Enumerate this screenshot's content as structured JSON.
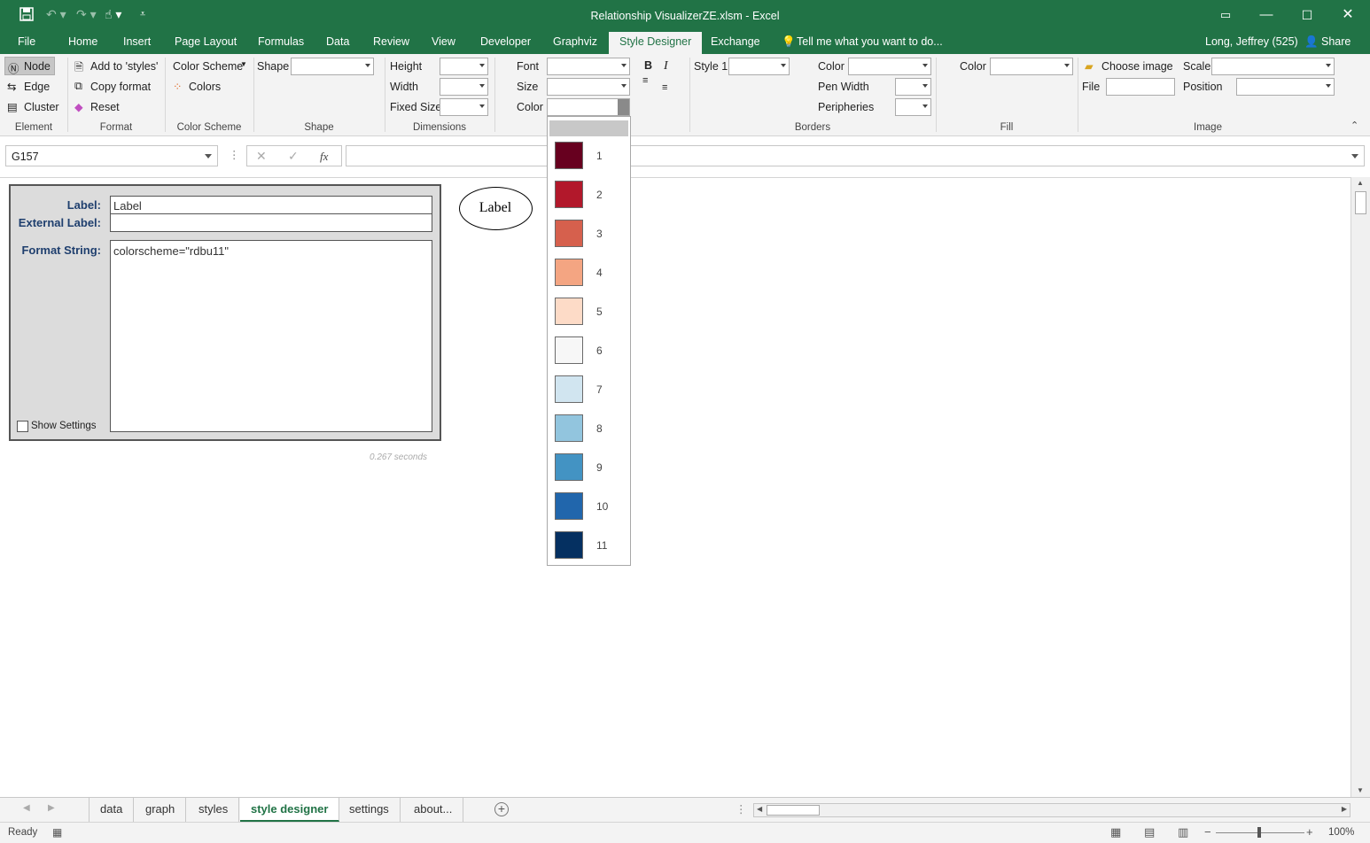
{
  "window": {
    "title": "Relationship VisualizerZE.xlsm - Excel"
  },
  "menu": {
    "tabs": [
      "File",
      "Home",
      "Insert",
      "Page Layout",
      "Formulas",
      "Data",
      "Review",
      "View",
      "Developer",
      "Graphviz",
      "Style Designer",
      "Exchange"
    ],
    "active": "Style Designer",
    "tell_me": "Tell me what you want to do...",
    "user": "Long, Jeffrey (525)",
    "share": "Share"
  },
  "ribbon": {
    "element": {
      "node": "Node",
      "edge": "Edge",
      "cluster": "Cluster",
      "group": "Element"
    },
    "format": {
      "add_styles": "Add to 'styles'",
      "copy_format": "Copy format",
      "reset": "Reset",
      "group": "Format"
    },
    "color_scheme": {
      "label": "Color Scheme",
      "colors": "Colors",
      "group": "Color Scheme"
    },
    "shape": {
      "label": "Shape",
      "group": "Shape"
    },
    "dimensions": {
      "height": "Height",
      "width": "Width",
      "fixed_size": "Fixed Size",
      "group": "Dimensions"
    },
    "font": {
      "font": "Font",
      "size": "Size",
      "color": "Color",
      "bold": "B",
      "italic": "I"
    },
    "style": {
      "label": "Style 1"
    },
    "borders": {
      "color": "Color",
      "pen_width": "Pen Width",
      "peripheries": "Peripheries",
      "group": "Borders"
    },
    "fill": {
      "color": "Color",
      "group": "Fill"
    },
    "image": {
      "choose_image": "Choose image",
      "file": "File",
      "scale": "Scale",
      "position": "Position",
      "group": "Image"
    }
  },
  "formula_bar": {
    "name_box": "G157",
    "fx": "fx",
    "formula": ""
  },
  "panel": {
    "label_caption": "Label:",
    "label_value": "Label",
    "external_label_caption": "External Label:",
    "external_label_value": "",
    "format_string_caption": "Format String:",
    "format_string_value": "colorscheme=\"rdbu11\"",
    "show_settings": "Show Settings",
    "show_settings_checked": false
  },
  "preview": {
    "node_label": "Label",
    "timing": "0.267 seconds"
  },
  "color_dropdown": {
    "items": [
      {
        "label": "1",
        "color": "#67001f"
      },
      {
        "label": "2",
        "color": "#b2182b"
      },
      {
        "label": "3",
        "color": "#d6604d"
      },
      {
        "label": "4",
        "color": "#f4a582"
      },
      {
        "label": "5",
        "color": "#fddbc7"
      },
      {
        "label": "6",
        "color": "#f7f7f7"
      },
      {
        "label": "7",
        "color": "#d1e5f0"
      },
      {
        "label": "8",
        "color": "#92c5de"
      },
      {
        "label": "9",
        "color": "#4393c3"
      },
      {
        "label": "10",
        "color": "#2166ac"
      },
      {
        "label": "11",
        "color": "#053061"
      }
    ]
  },
  "sheet_tabs": [
    "data",
    "graph",
    "styles",
    "style designer",
    "settings",
    "about..."
  ],
  "active_sheet": "style designer",
  "status": {
    "ready": "Ready",
    "zoom": "100%"
  },
  "colors": {
    "accent": "#217346"
  }
}
